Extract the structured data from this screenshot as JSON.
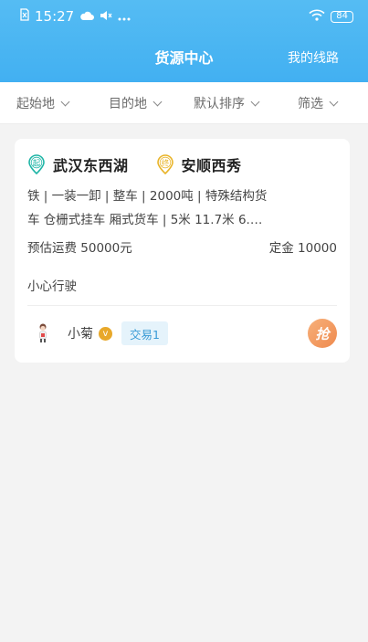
{
  "status_bar": {
    "time": "15:27",
    "battery": "84",
    "icons": [
      "sim-icon",
      "weather-icon",
      "mute-icon",
      "more-icon",
      "wifi-icon",
      "battery-icon"
    ]
  },
  "nav": {
    "title": "货源中心",
    "right_link": "我的线路"
  },
  "filters": [
    {
      "label": "起始地"
    },
    {
      "label": "目的地"
    },
    {
      "label": "默认排序"
    },
    {
      "label": "筛选"
    }
  ],
  "card": {
    "origin_badge": "起",
    "origin": "武汉东西湖",
    "dest_badge": "终",
    "destination": "安顺西秀",
    "cargo_line1": "铁 | 一装一卸 | 整车 | 2000吨 | 特殊结构货",
    "cargo_line2": "车 仓栅式挂车 厢式货车 | 5米 11.7米 6.…",
    "estimate": "预估运费 50000元",
    "deposit": "定金 10000",
    "note": "小心行驶",
    "user_name": "小菊",
    "vip_mark": "v",
    "trade_badge": "交易1",
    "grab_label": "抢"
  },
  "colors": {
    "header": "#42b0f2",
    "origin_pin": "#1fb5a6",
    "dest_pin": "#e9b429",
    "grab": "#ef8a4e",
    "trade_bg": "#e5f3fb"
  }
}
